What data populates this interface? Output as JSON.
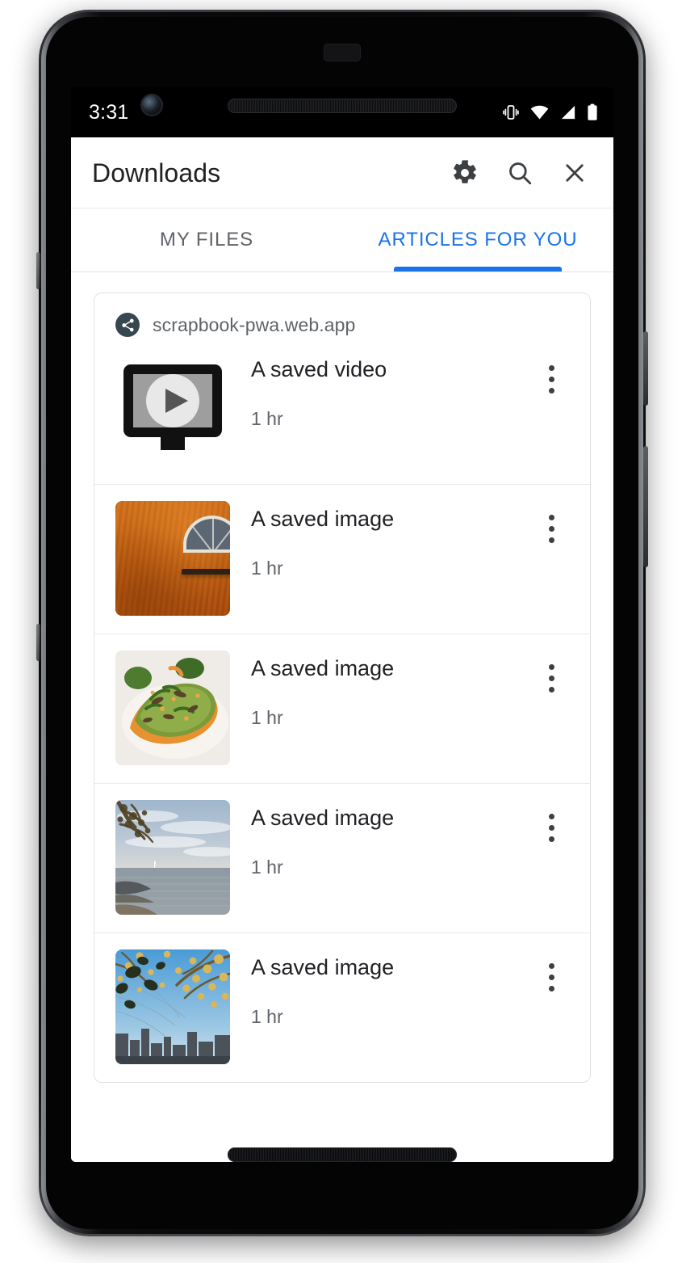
{
  "device": {
    "name": "pixel-phone-frame",
    "hardware": [
      "front-camera",
      "earpiece-speaker",
      "bottom-speaker",
      "power-button",
      "volume-button"
    ]
  },
  "status_bar": {
    "clock": "3:31",
    "icons": [
      "vibrate-icon",
      "wifi-icon",
      "cellular-signal-icon",
      "battery-icon"
    ]
  },
  "toolbar": {
    "title": "Downloads",
    "actions": [
      {
        "name": "settings-button",
        "icon": "gear-icon"
      },
      {
        "name": "search-button",
        "icon": "search-icon"
      },
      {
        "name": "close-button",
        "icon": "close-icon"
      }
    ]
  },
  "tabs": {
    "active_index": 1,
    "accent_color": "#1a73e8",
    "items": [
      {
        "label": "MY FILES",
        "active": false
      },
      {
        "label": "ARTICLES FOR YOU",
        "active": true
      }
    ]
  },
  "card": {
    "origin": {
      "icon": "share-icon",
      "badge_color": "#37474f",
      "text": "scrapbook-pwa.web.app"
    },
    "rows": [
      {
        "title": "A saved video",
        "subtitle": "1 hr",
        "thumbnail": "video-placeholder-icon",
        "menu_icon": "overflow-menu-icon"
      },
      {
        "title": "A saved image",
        "subtitle": "1 hr",
        "thumbnail": "orange-wall-arched-window-photo",
        "menu_icon": "overflow-menu-icon"
      },
      {
        "title": "A saved image",
        "subtitle": "1 hr",
        "thumbnail": "avocado-toast-photo",
        "menu_icon": "overflow-menu-icon"
      },
      {
        "title": "A saved image",
        "subtitle": "1 hr",
        "thumbnail": "lake-shore-photo",
        "menu_icon": "overflow-menu-icon"
      },
      {
        "title": "A saved image",
        "subtitle": "1 hr",
        "thumbnail": "city-skyline-autumn-branches-photo",
        "menu_icon": "overflow-menu-icon"
      }
    ]
  }
}
